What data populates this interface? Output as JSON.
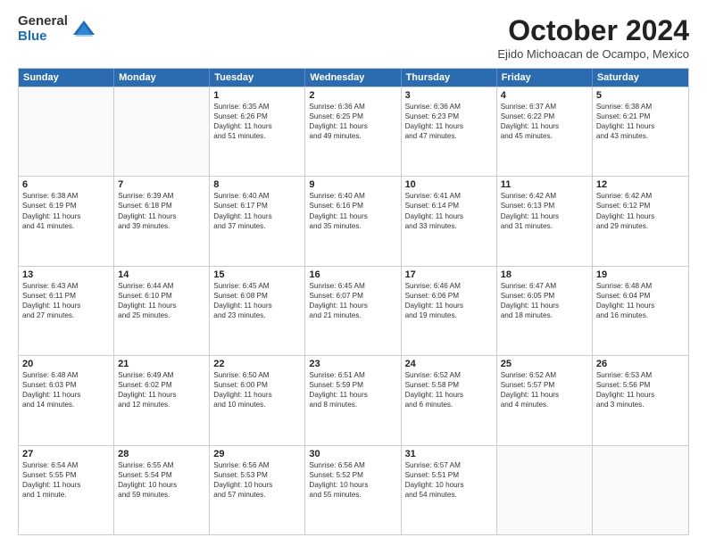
{
  "logo": {
    "general": "General",
    "blue": "Blue"
  },
  "title": "October 2024",
  "subtitle": "Ejido Michoacan de Ocampo, Mexico",
  "days": [
    "Sunday",
    "Monday",
    "Tuesday",
    "Wednesday",
    "Thursday",
    "Friday",
    "Saturday"
  ],
  "weeks": [
    [
      {
        "day": "",
        "lines": []
      },
      {
        "day": "",
        "lines": []
      },
      {
        "day": "1",
        "lines": [
          "Sunrise: 6:35 AM",
          "Sunset: 6:26 PM",
          "Daylight: 11 hours",
          "and 51 minutes."
        ]
      },
      {
        "day": "2",
        "lines": [
          "Sunrise: 6:36 AM",
          "Sunset: 6:25 PM",
          "Daylight: 11 hours",
          "and 49 minutes."
        ]
      },
      {
        "day": "3",
        "lines": [
          "Sunrise: 6:36 AM",
          "Sunset: 6:23 PM",
          "Daylight: 11 hours",
          "and 47 minutes."
        ]
      },
      {
        "day": "4",
        "lines": [
          "Sunrise: 6:37 AM",
          "Sunset: 6:22 PM",
          "Daylight: 11 hours",
          "and 45 minutes."
        ]
      },
      {
        "day": "5",
        "lines": [
          "Sunrise: 6:38 AM",
          "Sunset: 6:21 PM",
          "Daylight: 11 hours",
          "and 43 minutes."
        ]
      }
    ],
    [
      {
        "day": "6",
        "lines": [
          "Sunrise: 6:38 AM",
          "Sunset: 6:19 PM",
          "Daylight: 11 hours",
          "and 41 minutes."
        ]
      },
      {
        "day": "7",
        "lines": [
          "Sunrise: 6:39 AM",
          "Sunset: 6:18 PM",
          "Daylight: 11 hours",
          "and 39 minutes."
        ]
      },
      {
        "day": "8",
        "lines": [
          "Sunrise: 6:40 AM",
          "Sunset: 6:17 PM",
          "Daylight: 11 hours",
          "and 37 minutes."
        ]
      },
      {
        "day": "9",
        "lines": [
          "Sunrise: 6:40 AM",
          "Sunset: 6:16 PM",
          "Daylight: 11 hours",
          "and 35 minutes."
        ]
      },
      {
        "day": "10",
        "lines": [
          "Sunrise: 6:41 AM",
          "Sunset: 6:14 PM",
          "Daylight: 11 hours",
          "and 33 minutes."
        ]
      },
      {
        "day": "11",
        "lines": [
          "Sunrise: 6:42 AM",
          "Sunset: 6:13 PM",
          "Daylight: 11 hours",
          "and 31 minutes."
        ]
      },
      {
        "day": "12",
        "lines": [
          "Sunrise: 6:42 AM",
          "Sunset: 6:12 PM",
          "Daylight: 11 hours",
          "and 29 minutes."
        ]
      }
    ],
    [
      {
        "day": "13",
        "lines": [
          "Sunrise: 6:43 AM",
          "Sunset: 6:11 PM",
          "Daylight: 11 hours",
          "and 27 minutes."
        ]
      },
      {
        "day": "14",
        "lines": [
          "Sunrise: 6:44 AM",
          "Sunset: 6:10 PM",
          "Daylight: 11 hours",
          "and 25 minutes."
        ]
      },
      {
        "day": "15",
        "lines": [
          "Sunrise: 6:45 AM",
          "Sunset: 6:08 PM",
          "Daylight: 11 hours",
          "and 23 minutes."
        ]
      },
      {
        "day": "16",
        "lines": [
          "Sunrise: 6:45 AM",
          "Sunset: 6:07 PM",
          "Daylight: 11 hours",
          "and 21 minutes."
        ]
      },
      {
        "day": "17",
        "lines": [
          "Sunrise: 6:46 AM",
          "Sunset: 6:06 PM",
          "Daylight: 11 hours",
          "and 19 minutes."
        ]
      },
      {
        "day": "18",
        "lines": [
          "Sunrise: 6:47 AM",
          "Sunset: 6:05 PM",
          "Daylight: 11 hours",
          "and 18 minutes."
        ]
      },
      {
        "day": "19",
        "lines": [
          "Sunrise: 6:48 AM",
          "Sunset: 6:04 PM",
          "Daylight: 11 hours",
          "and 16 minutes."
        ]
      }
    ],
    [
      {
        "day": "20",
        "lines": [
          "Sunrise: 6:48 AM",
          "Sunset: 6:03 PM",
          "Daylight: 11 hours",
          "and 14 minutes."
        ]
      },
      {
        "day": "21",
        "lines": [
          "Sunrise: 6:49 AM",
          "Sunset: 6:02 PM",
          "Daylight: 11 hours",
          "and 12 minutes."
        ]
      },
      {
        "day": "22",
        "lines": [
          "Sunrise: 6:50 AM",
          "Sunset: 6:00 PM",
          "Daylight: 11 hours",
          "and 10 minutes."
        ]
      },
      {
        "day": "23",
        "lines": [
          "Sunrise: 6:51 AM",
          "Sunset: 5:59 PM",
          "Daylight: 11 hours",
          "and 8 minutes."
        ]
      },
      {
        "day": "24",
        "lines": [
          "Sunrise: 6:52 AM",
          "Sunset: 5:58 PM",
          "Daylight: 11 hours",
          "and 6 minutes."
        ]
      },
      {
        "day": "25",
        "lines": [
          "Sunrise: 6:52 AM",
          "Sunset: 5:57 PM",
          "Daylight: 11 hours",
          "and 4 minutes."
        ]
      },
      {
        "day": "26",
        "lines": [
          "Sunrise: 6:53 AM",
          "Sunset: 5:56 PM",
          "Daylight: 11 hours",
          "and 3 minutes."
        ]
      }
    ],
    [
      {
        "day": "27",
        "lines": [
          "Sunrise: 6:54 AM",
          "Sunset: 5:55 PM",
          "Daylight: 11 hours",
          "and 1 minute."
        ]
      },
      {
        "day": "28",
        "lines": [
          "Sunrise: 6:55 AM",
          "Sunset: 5:54 PM",
          "Daylight: 10 hours",
          "and 59 minutes."
        ]
      },
      {
        "day": "29",
        "lines": [
          "Sunrise: 6:56 AM",
          "Sunset: 5:53 PM",
          "Daylight: 10 hours",
          "and 57 minutes."
        ]
      },
      {
        "day": "30",
        "lines": [
          "Sunrise: 6:56 AM",
          "Sunset: 5:52 PM",
          "Daylight: 10 hours",
          "and 55 minutes."
        ]
      },
      {
        "day": "31",
        "lines": [
          "Sunrise: 6:57 AM",
          "Sunset: 5:51 PM",
          "Daylight: 10 hours",
          "and 54 minutes."
        ]
      },
      {
        "day": "",
        "lines": []
      },
      {
        "day": "",
        "lines": []
      }
    ]
  ]
}
